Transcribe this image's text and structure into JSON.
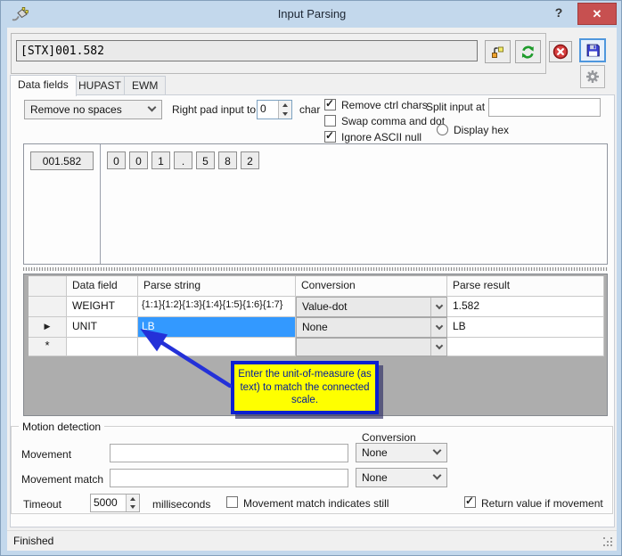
{
  "window": {
    "title": "Input Parsing",
    "help_glyph": "?",
    "close_glyph": "✕",
    "status": "Finished"
  },
  "toolbar": {
    "input_value": "[STX]001.582",
    "icons": [
      "plug-icon",
      "transfer-icon",
      "refresh-icon",
      "stop-icon",
      "save-icon",
      "gear-icon"
    ]
  },
  "tabs": [
    {
      "label": "Data fields",
      "active": true
    },
    {
      "label": "HUPAST",
      "active": false
    },
    {
      "label": "EWM",
      "active": false
    }
  ],
  "options": {
    "spaces_dropdown_value": "Remove no spaces",
    "right_pad_label": "Right pad input to",
    "right_pad_value": "0",
    "char_label": "char",
    "checkboxes": [
      {
        "label": "Remove ctrl chars",
        "checked": true
      },
      {
        "label": "Swap comma and dot",
        "checked": false
      },
      {
        "label": "Ignore ASCII null",
        "checked": true
      }
    ],
    "split_label": "Split input at",
    "split_value": "",
    "display_hex_label": "Display hex",
    "display_hex_selected": false
  },
  "parse_preview": {
    "full": "001.582",
    "chars": [
      "0",
      "0",
      "1",
      ".",
      "5",
      "8",
      "2"
    ]
  },
  "grid": {
    "columns": {
      "c0": "",
      "c1": "Data field",
      "c2": "Parse string",
      "c3": "Conversion",
      "c4": "Parse result"
    },
    "rows": [
      {
        "marker": "",
        "data_field": "WEIGHT",
        "parse_string": "{1:1}{1:2}{1:3}{1:4}{1:5}{1:6}{1:7}",
        "conversion": "Value-dot",
        "parse_result": "1.582"
      },
      {
        "marker": "▶",
        "data_field": "UNIT",
        "parse_string": "LB",
        "conversion": "None",
        "parse_result": "LB",
        "selected_cell": "parse_string"
      },
      {
        "marker": "*",
        "data_field": "",
        "parse_string": "",
        "conversion": "",
        "parse_result": ""
      }
    ]
  },
  "tooltip": {
    "text": "Enter the unit-of-measure (as text) to match the connected scale.",
    "bg": "#ffff00",
    "border": "#0b1fd0"
  },
  "motion": {
    "title": "Motion detection",
    "conversion_label": "Conversion",
    "movement_label": "Movement",
    "movement_value": "",
    "movement_conversion": "None",
    "match_label": "Movement match",
    "match_value": "",
    "match_conversion": "None",
    "timeout_label": "Timeout",
    "timeout_value": "5000",
    "timeout_unit": "milliseconds",
    "still_checkbox": {
      "label": "Movement match indicates still",
      "checked": false
    },
    "return_checkbox": {
      "label": "Return value if movement",
      "checked": true
    }
  },
  "glyphs": {
    "check": "✓"
  },
  "colors": {
    "titlebar": "#c3d8ec",
    "close_red": "#c75050",
    "selection_blue": "#3399ff",
    "grid_back": "#adadad"
  }
}
